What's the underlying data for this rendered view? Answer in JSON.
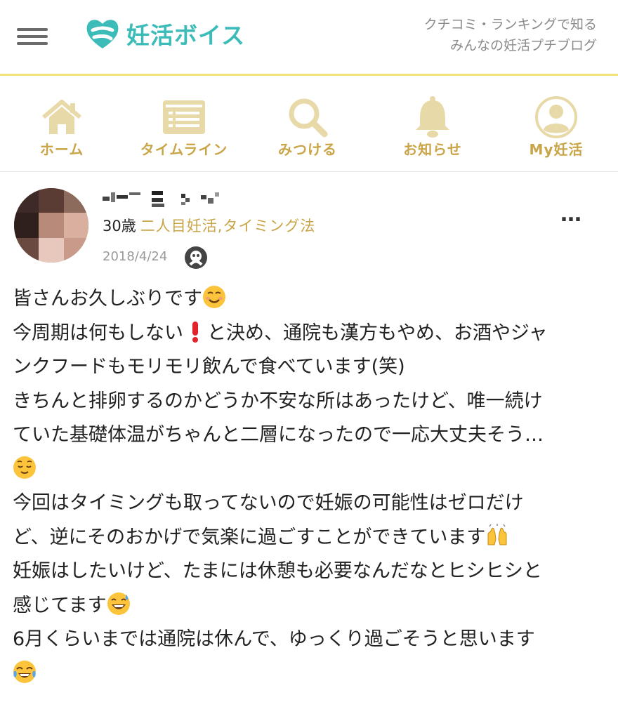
{
  "header": {
    "logo_text": "妊活ボイス",
    "tagline_line1": "クチコミ・ランキングで知る",
    "tagline_line2": "みんなの妊活プチブログ",
    "colors": {
      "brand": "#3bbcb8",
      "accent": "#c9a548",
      "divider": "#f2e27a"
    }
  },
  "nav": {
    "items": [
      {
        "label": "ホーム",
        "icon": "home-icon"
      },
      {
        "label": "タイムライン",
        "icon": "timeline-icon"
      },
      {
        "label": "みつける",
        "icon": "search-icon"
      },
      {
        "label": "お知らせ",
        "icon": "bell-icon"
      },
      {
        "label": "My妊活",
        "icon": "user-icon"
      }
    ]
  },
  "post": {
    "age": "30歳",
    "tags": "二人目妊活,タイミング法",
    "date": "2018/4/24",
    "more": "…",
    "lines": [
      "皆さんお久しぶりです",
      "今周期は何もしない",
      "と決め、通院も漢方もやめ、お酒やジャ",
      "ンクフードもモリモリ飲んで食べています(笑)",
      "きちんと排卵するのかどうか不安な所はあったけど、唯一続け",
      "ていた基礎体温がちゃんと二層になったので一応大丈夫そう…",
      "今回はタイミングも取ってないので妊娠の可能性はゼロだけ",
      "ど、逆にそのおかげで気楽に過ごすことができています",
      "妊娠はしたいけど、たまには休憩も必要なんだなとヒシヒシと",
      "感じてます",
      "6月くらいまでは通院は休んで、ゆっくり過ごそうと思います"
    ]
  }
}
